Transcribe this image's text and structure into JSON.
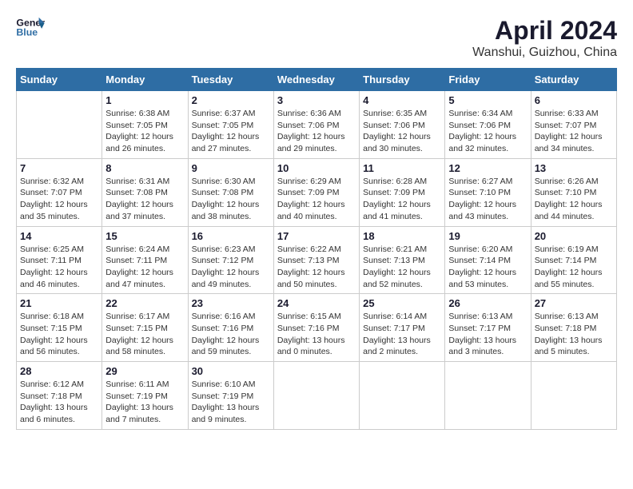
{
  "header": {
    "logo_line1": "General",
    "logo_line2": "Blue",
    "month": "April 2024",
    "location": "Wanshui, Guizhou, China"
  },
  "weekdays": [
    "Sunday",
    "Monday",
    "Tuesday",
    "Wednesday",
    "Thursday",
    "Friday",
    "Saturday"
  ],
  "weeks": [
    [
      {
        "day": "",
        "info": ""
      },
      {
        "day": "1",
        "info": "Sunrise: 6:38 AM\nSunset: 7:05 PM\nDaylight: 12 hours\nand 26 minutes."
      },
      {
        "day": "2",
        "info": "Sunrise: 6:37 AM\nSunset: 7:05 PM\nDaylight: 12 hours\nand 27 minutes."
      },
      {
        "day": "3",
        "info": "Sunrise: 6:36 AM\nSunset: 7:06 PM\nDaylight: 12 hours\nand 29 minutes."
      },
      {
        "day": "4",
        "info": "Sunrise: 6:35 AM\nSunset: 7:06 PM\nDaylight: 12 hours\nand 30 minutes."
      },
      {
        "day": "5",
        "info": "Sunrise: 6:34 AM\nSunset: 7:06 PM\nDaylight: 12 hours\nand 32 minutes."
      },
      {
        "day": "6",
        "info": "Sunrise: 6:33 AM\nSunset: 7:07 PM\nDaylight: 12 hours\nand 34 minutes."
      }
    ],
    [
      {
        "day": "7",
        "info": "Sunrise: 6:32 AM\nSunset: 7:07 PM\nDaylight: 12 hours\nand 35 minutes."
      },
      {
        "day": "8",
        "info": "Sunrise: 6:31 AM\nSunset: 7:08 PM\nDaylight: 12 hours\nand 37 minutes."
      },
      {
        "day": "9",
        "info": "Sunrise: 6:30 AM\nSunset: 7:08 PM\nDaylight: 12 hours\nand 38 minutes."
      },
      {
        "day": "10",
        "info": "Sunrise: 6:29 AM\nSunset: 7:09 PM\nDaylight: 12 hours\nand 40 minutes."
      },
      {
        "day": "11",
        "info": "Sunrise: 6:28 AM\nSunset: 7:09 PM\nDaylight: 12 hours\nand 41 minutes."
      },
      {
        "day": "12",
        "info": "Sunrise: 6:27 AM\nSunset: 7:10 PM\nDaylight: 12 hours\nand 43 minutes."
      },
      {
        "day": "13",
        "info": "Sunrise: 6:26 AM\nSunset: 7:10 PM\nDaylight: 12 hours\nand 44 minutes."
      }
    ],
    [
      {
        "day": "14",
        "info": "Sunrise: 6:25 AM\nSunset: 7:11 PM\nDaylight: 12 hours\nand 46 minutes."
      },
      {
        "day": "15",
        "info": "Sunrise: 6:24 AM\nSunset: 7:11 PM\nDaylight: 12 hours\nand 47 minutes."
      },
      {
        "day": "16",
        "info": "Sunrise: 6:23 AM\nSunset: 7:12 PM\nDaylight: 12 hours\nand 49 minutes."
      },
      {
        "day": "17",
        "info": "Sunrise: 6:22 AM\nSunset: 7:13 PM\nDaylight: 12 hours\nand 50 minutes."
      },
      {
        "day": "18",
        "info": "Sunrise: 6:21 AM\nSunset: 7:13 PM\nDaylight: 12 hours\nand 52 minutes."
      },
      {
        "day": "19",
        "info": "Sunrise: 6:20 AM\nSunset: 7:14 PM\nDaylight: 12 hours\nand 53 minutes."
      },
      {
        "day": "20",
        "info": "Sunrise: 6:19 AM\nSunset: 7:14 PM\nDaylight: 12 hours\nand 55 minutes."
      }
    ],
    [
      {
        "day": "21",
        "info": "Sunrise: 6:18 AM\nSunset: 7:15 PM\nDaylight: 12 hours\nand 56 minutes."
      },
      {
        "day": "22",
        "info": "Sunrise: 6:17 AM\nSunset: 7:15 PM\nDaylight: 12 hours\nand 58 minutes."
      },
      {
        "day": "23",
        "info": "Sunrise: 6:16 AM\nSunset: 7:16 PM\nDaylight: 12 hours\nand 59 minutes."
      },
      {
        "day": "24",
        "info": "Sunrise: 6:15 AM\nSunset: 7:16 PM\nDaylight: 13 hours\nand 0 minutes."
      },
      {
        "day": "25",
        "info": "Sunrise: 6:14 AM\nSunset: 7:17 PM\nDaylight: 13 hours\nand 2 minutes."
      },
      {
        "day": "26",
        "info": "Sunrise: 6:13 AM\nSunset: 7:17 PM\nDaylight: 13 hours\nand 3 minutes."
      },
      {
        "day": "27",
        "info": "Sunrise: 6:13 AM\nSunset: 7:18 PM\nDaylight: 13 hours\nand 5 minutes."
      }
    ],
    [
      {
        "day": "28",
        "info": "Sunrise: 6:12 AM\nSunset: 7:18 PM\nDaylight: 13 hours\nand 6 minutes."
      },
      {
        "day": "29",
        "info": "Sunrise: 6:11 AM\nSunset: 7:19 PM\nDaylight: 13 hours\nand 7 minutes."
      },
      {
        "day": "30",
        "info": "Sunrise: 6:10 AM\nSunset: 7:19 PM\nDaylight: 13 hours\nand 9 minutes."
      },
      {
        "day": "",
        "info": ""
      },
      {
        "day": "",
        "info": ""
      },
      {
        "day": "",
        "info": ""
      },
      {
        "day": "",
        "info": ""
      }
    ]
  ]
}
